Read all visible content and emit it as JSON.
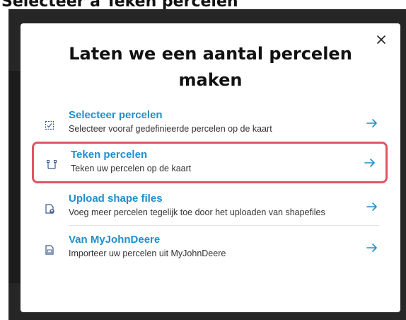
{
  "caption": "Selecteer a Teken percelen",
  "dialog": {
    "title": "Laten we een aantal percelen maken",
    "close_icon": "close-icon",
    "options": [
      {
        "title": "Selecteer percelen",
        "description": "Selecteer vooraf gedefinieerde percelen op de kaart",
        "icon": "select-parcel-icon",
        "highlighted": false
      },
      {
        "title": "Teken percelen",
        "description": "Teken uw percelen op de kaart",
        "icon": "draw-parcel-icon",
        "highlighted": true
      },
      {
        "title": "Upload shape files",
        "description": "Voeg meer percelen tegelijk toe door het uploaden van shapefiles",
        "icon": "upload-file-icon",
        "highlighted": false
      },
      {
        "title": "Van MyJohnDeere",
        "description": "Importeer uw percelen uit MyJohnDeere",
        "icon": "import-file-icon",
        "highlighted": false
      }
    ]
  },
  "colors": {
    "link": "#1f8fcc",
    "highlight": "#e05565",
    "backdrop": "#262626"
  }
}
